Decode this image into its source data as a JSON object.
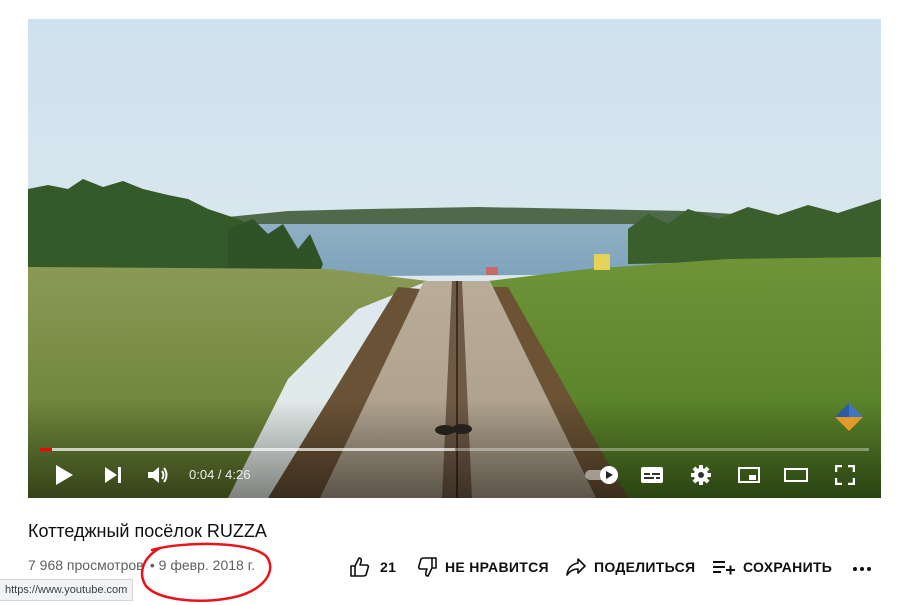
{
  "player": {
    "current_time": "0:04",
    "duration": "4:26",
    "time_display": "0:04 / 4:26",
    "progress_fraction": 0.015,
    "buffer_fraction": 0.5,
    "autoplay_on": true,
    "icons": [
      "play-icon",
      "next-icon",
      "volume-icon",
      "autoplay-toggle-icon",
      "subtitles-icon",
      "settings-icon",
      "miniplayer-icon",
      "theater-mode-icon",
      "fullscreen-icon"
    ]
  },
  "video": {
    "title": "Коттеджный посёлок RUZZA",
    "views": "7 968 просмотров",
    "date": "• 9 февр. 2018 г."
  },
  "actions": {
    "like_count": "21",
    "dislike_label": "НЕ НРАВИТСЯ",
    "share_label": "ПОДЕЛИТЬСЯ",
    "save_label": "СОХРАНИТЬ",
    "more_icon": "more-horizontal-icon"
  },
  "status_bar": {
    "url": "https://www.youtube.com"
  },
  "colors": {
    "progress": "#ff0000",
    "annotation": "#e8141b",
    "text_primary": "#0f0f0f",
    "text_secondary": "#606060"
  }
}
